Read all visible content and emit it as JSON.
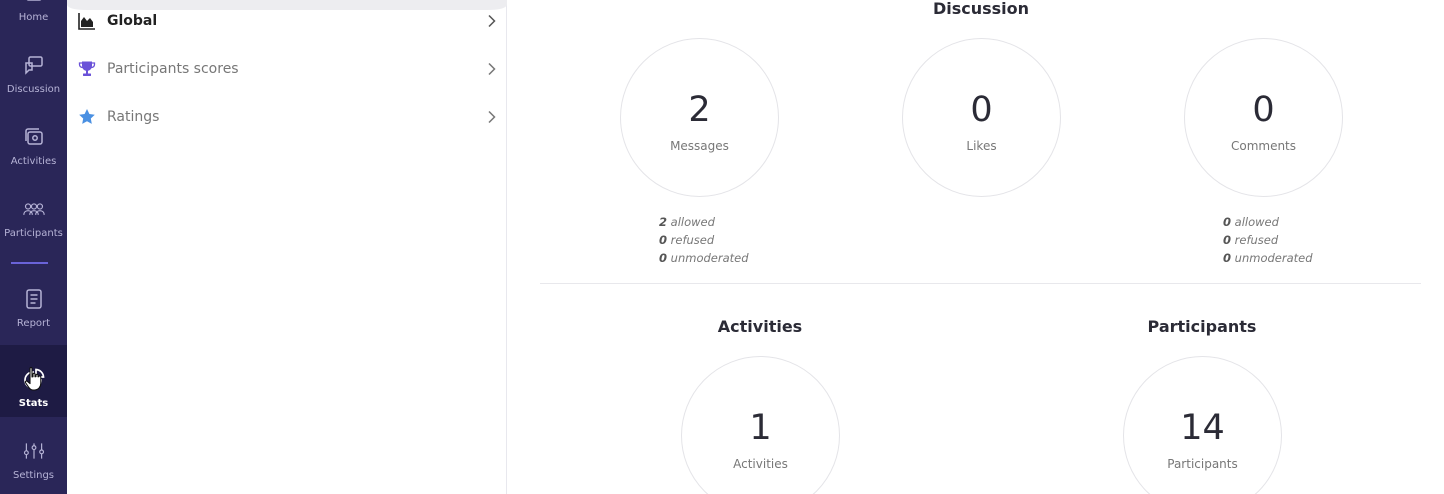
{
  "rail": {
    "items": [
      {
        "label": "Home",
        "icon": "home-icon"
      },
      {
        "label": "Discussion",
        "icon": "discussion-icon"
      },
      {
        "label": "Activities",
        "icon": "activities-icon"
      },
      {
        "label": "Participants",
        "icon": "participants-icon"
      },
      {
        "label": "Report",
        "icon": "report-icon"
      },
      {
        "label": "Stats",
        "icon": "stats-icon",
        "active": true
      },
      {
        "label": "Settings",
        "icon": "settings-icon"
      }
    ]
  },
  "submenu": {
    "items": [
      {
        "label": "Global",
        "icon": "area-chart-icon",
        "active": true
      },
      {
        "label": "Participants scores",
        "icon": "trophy-icon"
      },
      {
        "label": "Ratings",
        "icon": "star-icon"
      }
    ]
  },
  "discussion": {
    "title": "Discussion",
    "messages": {
      "value": "2",
      "label": "Messages",
      "allowed": "2",
      "refused": "0",
      "unmoderated": "0"
    },
    "likes": {
      "value": "0",
      "label": "Likes"
    },
    "comments": {
      "value": "0",
      "label": "Comments",
      "allowed": "0",
      "refused": "0",
      "unmoderated": "0"
    },
    "allowed_label": "allowed",
    "refused_label": "refused",
    "unmoderated_label": "unmoderated"
  },
  "activities": {
    "title": "Activities",
    "value": "1",
    "label": "Activities"
  },
  "participants": {
    "title": "Participants",
    "value": "14",
    "label": "Participants"
  },
  "colors": {
    "rail_bg": "#2a2658",
    "rail_active": "#1e1b44",
    "accent": "#6a63d8",
    "trophy": "#6a52d8",
    "star": "#4a90e2"
  }
}
